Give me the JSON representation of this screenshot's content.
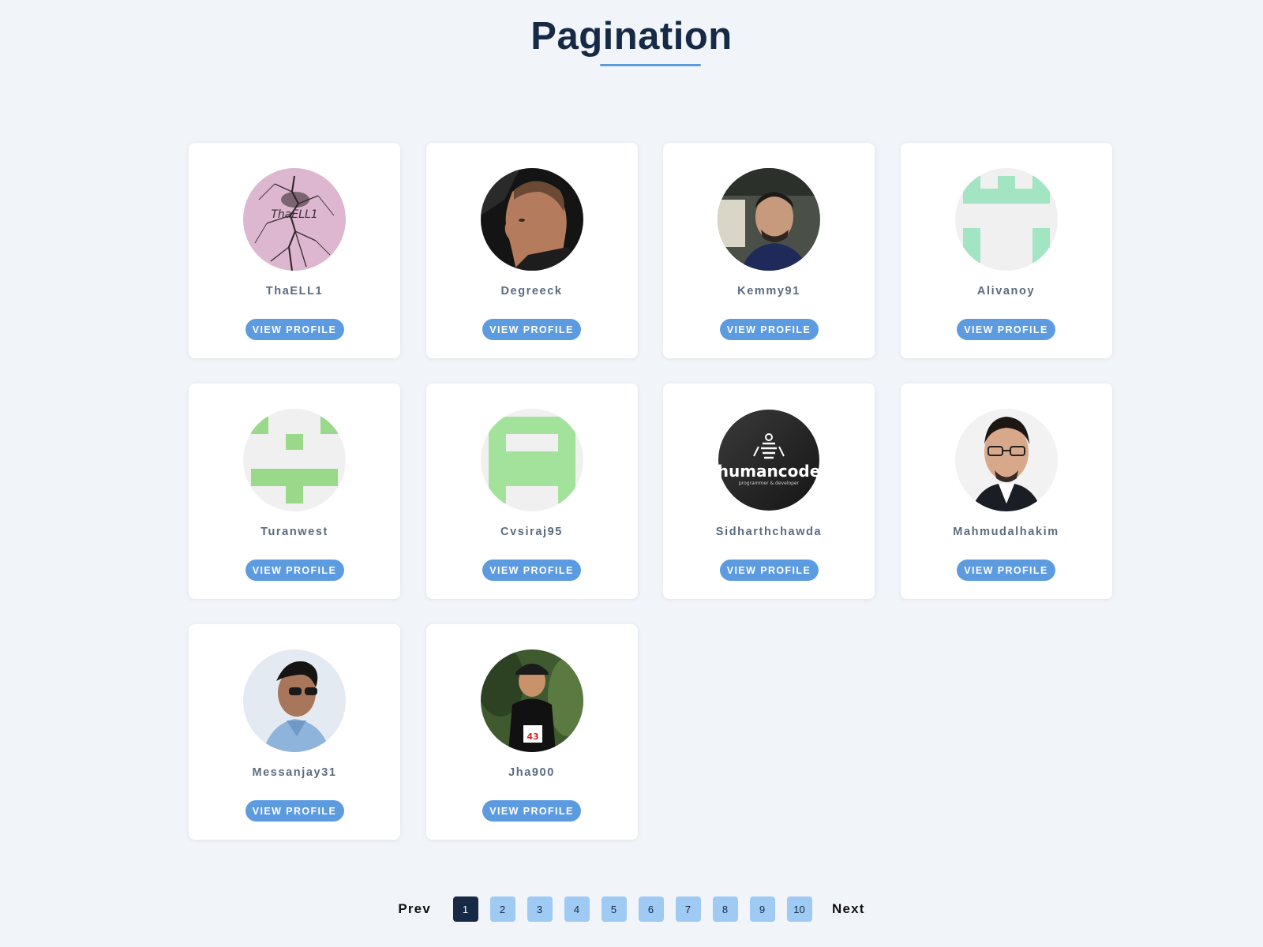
{
  "page": {
    "title": "Pagination"
  },
  "users": [
    {
      "name": "ThaELL1",
      "avatar": "cracked-glass-logo-avatar",
      "avatar_text": "ThaELL1",
      "button": "VIEW PROFILE"
    },
    {
      "name": "Degreeck",
      "avatar": "man-profile-photo-avatar",
      "button": "VIEW PROFILE"
    },
    {
      "name": "Kemmy91",
      "avatar": "man-in-car-photo-avatar",
      "button": "VIEW PROFILE"
    },
    {
      "name": "Alivanoy",
      "avatar": "identicon-avatar",
      "button": "VIEW PROFILE"
    },
    {
      "name": "Turanwest",
      "avatar": "identicon-avatar",
      "button": "VIEW PROFILE"
    },
    {
      "name": "Cvsiraj95",
      "avatar": "identicon-avatar",
      "button": "VIEW PROFILE"
    },
    {
      "name": "Sidharthchawda",
      "avatar": "humancode-logo-avatar",
      "avatar_text": "humancode",
      "avatar_subtext": "programmer & developer",
      "button": "VIEW PROFILE"
    },
    {
      "name": "Mahmudalhakim",
      "avatar": "man-with-glasses-photo-avatar",
      "button": "VIEW PROFILE"
    },
    {
      "name": "Messanjay31",
      "avatar": "man-with-sunglasses-photo-avatar",
      "button": "VIEW PROFILE"
    },
    {
      "name": "Jha900",
      "avatar": "runner-photo-avatar",
      "avatar_text": "43",
      "button": "VIEW PROFILE"
    }
  ],
  "pagination": {
    "prev": "Prev",
    "next": "Next",
    "pages": [
      "1",
      "2",
      "3",
      "4",
      "5",
      "6",
      "7",
      "8",
      "9",
      "10"
    ],
    "current": "1"
  },
  "colors": {
    "background": "#f1f4f8",
    "title": "#172a45",
    "accent": "#5d9be0",
    "page_button": "#9fcaf4",
    "page_active": "#172a45",
    "username": "#5a6b80",
    "identicon_green_1": "#a3e4c2",
    "identicon_green_2": "#9ad98a",
    "identicon_green_3": "#a3e29a"
  }
}
